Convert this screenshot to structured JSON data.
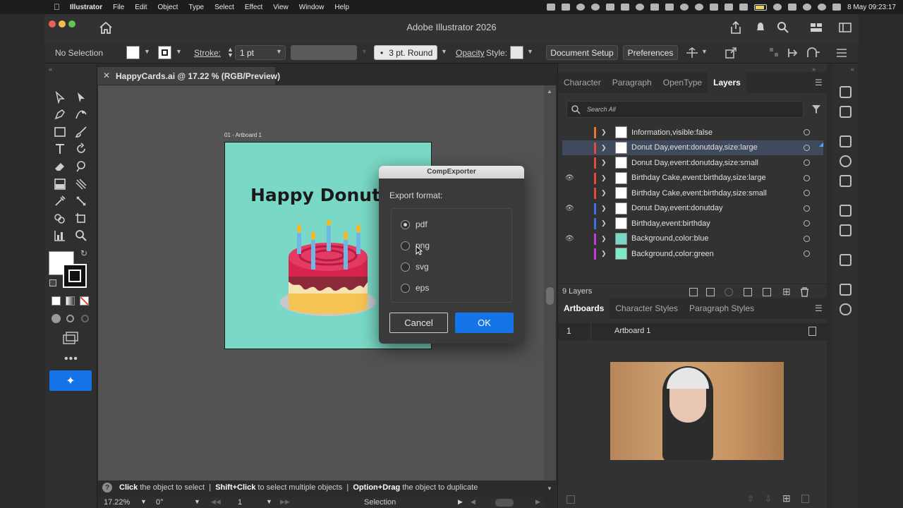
{
  "menubar": {
    "items": [
      "Illustrator",
      "File",
      "Edit",
      "Object",
      "Type",
      "Select",
      "Effect",
      "View",
      "Window",
      "Help"
    ],
    "datetime": "8 May  09:23:17"
  },
  "window": {
    "title": "Adobe Illustrator 2026"
  },
  "controlbar": {
    "selection": "No Selection",
    "stroke_label": "Stroke:",
    "stroke_value": "1 pt",
    "brush_value": "3 pt. Round",
    "opacity_label": "Opacity",
    "style_label": "Style:",
    "document_setup": "Document Setup",
    "preferences": "Preferences"
  },
  "document": {
    "tab_title": "HappyCards.ai @ 17.22 % (RGB/Preview)",
    "artboard_label": "01 - Artboard 1",
    "artboard_heading": "Happy Donut Da",
    "artboard_color": "#7ad9c6"
  },
  "dialog": {
    "title": "CompExporter",
    "prompt": "Export format:",
    "options": [
      "pdf",
      "png",
      "svg",
      "eps"
    ],
    "selected": "pdf",
    "cancel": "Cancel",
    "ok": "OK"
  },
  "panels": {
    "top_tabs": [
      "Character",
      "Paragraph",
      "OpenType",
      "Layers"
    ],
    "active_tab": "Layers",
    "search_placeholder": "Search All",
    "layers": [
      {
        "name": "Information,visible:false",
        "color": "#e8752a",
        "visible": false,
        "selected": false
      },
      {
        "name": "Donut Day,event:donutday,size:large",
        "color": "#e64a3a",
        "visible": false,
        "selected": true
      },
      {
        "name": "Donut Day,event:donutday,size:small",
        "color": "#e64a3a",
        "visible": false,
        "selected": false
      },
      {
        "name": "Birthday Cake,event:birthday,size:large",
        "color": "#e64a3a",
        "visible": true,
        "selected": false
      },
      {
        "name": "Birthday Cake,event:birthday,size:small",
        "color": "#e64a3a",
        "visible": false,
        "selected": false
      },
      {
        "name": "Donut Day,event:donutday",
        "color": "#3d6fe0",
        "visible": true,
        "selected": false
      },
      {
        "name": "Birthday,event:birthday",
        "color": "#3d6fe0",
        "visible": false,
        "selected": false
      },
      {
        "name": "Background,color:blue",
        "color": "#c23ad8",
        "visible": true,
        "selected": false
      },
      {
        "name": "Background,color:green",
        "color": "#c23ad8",
        "visible": false,
        "selected": false
      }
    ],
    "layers_count": "9 Layers",
    "bottom_tabs": [
      "Artboards",
      "Character Styles",
      "Paragraph Styles"
    ],
    "active_bottom_tab": "Artboards",
    "artboard_row": {
      "index": "1",
      "name": "Artboard 1"
    }
  },
  "hint": {
    "click": "Click",
    "click_text": "the object to select",
    "shift_click": "Shift+Click",
    "shift_text": "to select multiple objects",
    "option_drag": "Option+Drag",
    "option_text": "the object to duplicate"
  },
  "statusbar": {
    "zoom": "17.22%",
    "rotation": "0°",
    "artboard_nav": "1",
    "tool": "Selection"
  }
}
